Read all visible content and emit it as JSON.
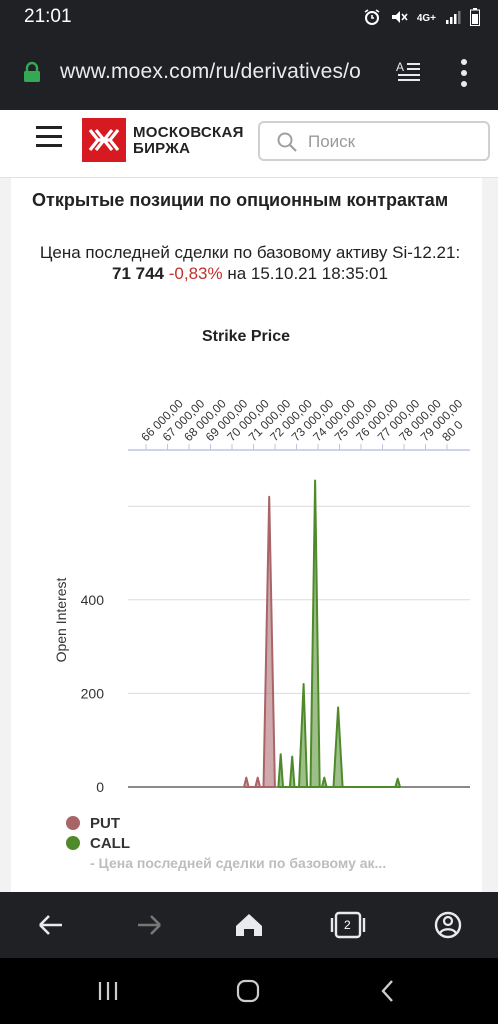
{
  "status_bar": {
    "time": "21:01",
    "network_label": "4G+"
  },
  "browser": {
    "url": "www.moex.com/ru/derivatives/o",
    "tab_count": "2"
  },
  "site": {
    "logo_line1": "МОСКОВСКАЯ",
    "logo_line2": "БИРЖА",
    "search_placeholder": "Поиск"
  },
  "content": {
    "title": "Открытые позиции по опционным контрактам",
    "price_prefix": "Цена последней сделки по базовому активу Si-12.21: ",
    "price_value": "71 744",
    "price_change": "-0,83%",
    "price_suffix": " на 15.10.21 18:35:01"
  },
  "chart_data": {
    "type": "area",
    "title": "Strike Price",
    "ylabel": "Open Interest",
    "ylim": [
      0,
      640
    ],
    "y_ticks": [
      0,
      200,
      400
    ],
    "x_tick_labels": [
      "66 000,00",
      "67 000,00",
      "68 000,00",
      "69 000,00",
      "70 000,00",
      "71 000,00",
      "72 000,00",
      "73 000,00",
      "74 000,00",
      "75 000,00",
      "76 000,00",
      "77 000,00",
      "78 000,00",
      "79 000,00",
      "80 0"
    ],
    "series": [
      {
        "name": "PUT",
        "color": "#a86467",
        "points": [
          [
            70400,
            0
          ],
          [
            70500,
            20
          ],
          [
            70600,
            0
          ],
          [
            70900,
            0
          ],
          [
            71000,
            20
          ],
          [
            71100,
            0
          ],
          [
            71250,
            0
          ],
          [
            71500,
            620
          ],
          [
            71750,
            0
          ]
        ]
      },
      {
        "name": "CALL",
        "color": "#4f8a2a",
        "points": [
          [
            71900,
            0
          ],
          [
            72000,
            70
          ],
          [
            72100,
            0
          ],
          [
            72400,
            0
          ],
          [
            72500,
            65
          ],
          [
            72600,
            0
          ],
          [
            72800,
            0
          ],
          [
            73000,
            220
          ],
          [
            73150,
            0
          ],
          [
            73300,
            0
          ],
          [
            73500,
            655
          ],
          [
            73700,
            0
          ],
          [
            73800,
            0
          ],
          [
            73900,
            20
          ],
          [
            74000,
            0
          ],
          [
            74300,
            0
          ],
          [
            74500,
            170
          ],
          [
            74700,
            0
          ],
          [
            77000,
            0
          ],
          [
            77100,
            18
          ],
          [
            77200,
            0
          ]
        ]
      }
    ],
    "legend": [
      {
        "name": "PUT",
        "color": "#a86467"
      },
      {
        "name": "CALL",
        "color": "#4f8a2a"
      },
      {
        "name": "- Цена последней сделки по базовому ак...",
        "color": "#bdbdbd"
      }
    ]
  }
}
